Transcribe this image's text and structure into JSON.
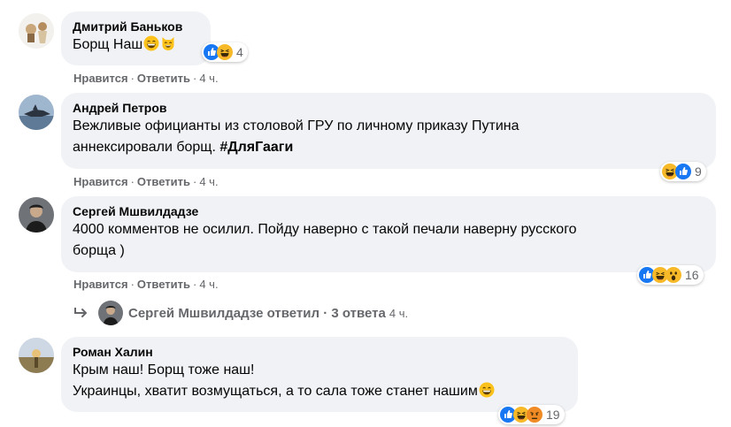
{
  "comments": [
    {
      "author": "Дмитрий Баньков",
      "text": "Борщ Наш",
      "emojis": [
        "grinning-face-icon",
        "cat-face-icon"
      ],
      "reaction_count": "4",
      "reaction_icons": [
        "like-icon",
        "haha-icon"
      ],
      "like_label": "Нравится",
      "reply_label": "Ответить",
      "time": "4 ч."
    },
    {
      "author": "Андрей Петров",
      "text_line1": "Вежливые официанты из столовой ГРУ по личному приказу Путина",
      "text_line2_plain": "аннексировали борщ. ",
      "hashtag": "#ДляГааги",
      "reaction_count": "9",
      "reaction_icons": [
        "haha-icon",
        "like-icon"
      ],
      "like_label": "Нравится",
      "reply_label": "Ответить",
      "time": "4 ч."
    },
    {
      "author": "Сергей Мшвилдадзе",
      "text": "4000 комментов не осилил. Пойду наверно с такой печали наверну русского\nборща )",
      "reaction_count": "16",
      "reaction_icons": [
        "like-icon",
        "haha-icon",
        "wow-icon"
      ],
      "like_label": "Нравится",
      "reply_label": "Ответить",
      "time": "4 ч."
    },
    {
      "author": "Роман Халин",
      "text_line1": "Крым наш! Борщ тоже наш!",
      "text_line2": "Украинцы, хватит возмущаться, а то сала тоже станет нашим",
      "emojis": [
        "grinning-face-icon"
      ],
      "reaction_count": "19",
      "reaction_icons": [
        "like-icon",
        "haha-icon",
        "angry-icon"
      ]
    }
  ],
  "replies_link": {
    "text": "Сергей Мшвилдадзе ответил · 3 ответа",
    "time": "4 ч."
  },
  "colors": {
    "bubble": "#f0f2f5",
    "meta": "#65676b",
    "like": "#1877f2",
    "haha": "#f7b928"
  }
}
